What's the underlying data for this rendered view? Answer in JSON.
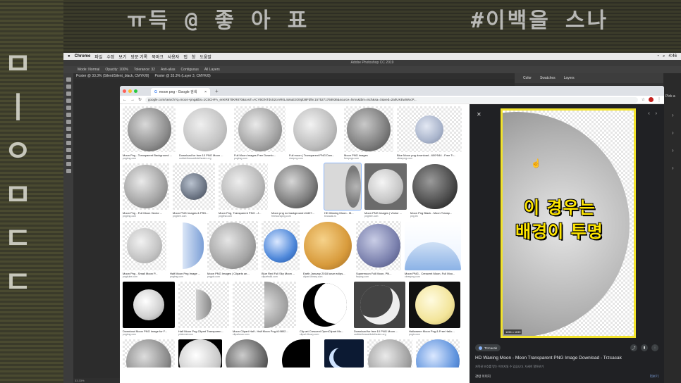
{
  "overlay": {
    "top_left": "ㅠ득 @ 좋 아 표",
    "top_right": "#이백을 스나",
    "left_column": "ㅁ ㅣ ㅇ ㅁ ㄷ ㄷ"
  },
  "menubar": {
    "app": "Chrome",
    "items": [
      "파일",
      "수정",
      "보기",
      "방문 기록",
      "북마크",
      "사용자",
      "탭",
      "창",
      "도움말"
    ],
    "right": "4:46"
  },
  "photoshop": {
    "title": "Adobe Photoshop CC 2019",
    "options": [
      "Mode: Normal",
      "Opacity: 100%",
      "Tolerance: 32",
      "Anti-alias",
      "Contiguous",
      "All Layers"
    ],
    "doc_tabs": [
      "Poster @ 33.3% (Silent/Silent_black, CMYK/8)",
      "Poster @ 33.3% (Layer 3, CMYK/8)"
    ],
    "panel_tabs": [
      "Color",
      "Swatches",
      "Layers"
    ],
    "side_label": "Pick a",
    "status": "33.33%"
  },
  "browser": {
    "tab_title": "moon png - Google 검색",
    "url": "google.com/search?q=moon+png&tbs=1C5CHFA_enKR870KR870&sxsrf=ACYBGNTdsS2cmR0L4s6uE3O0pl38Fdfw:1575271768936&source=lnms&tbm=isch&sa=X&ved=2ahUKEwiWxcP..."
  },
  "results": [
    [
      {
        "caption": "Moon Png - Transparent Background ...",
        "source": "pngimg.com"
      },
      {
        "caption": "Download for free 10 PNG Moon ...",
        "source": "carlisletheacarlisletheatre.org"
      },
      {
        "caption": "Full Moon Images Free Downlo...",
        "source": "pngimg.com"
      },
      {
        "caption": "Full moon | Transparent PNG Dow...",
        "source": "nicepng.com"
      },
      {
        "caption": "Moon PNG images",
        "source": "freepngs.com"
      },
      {
        "caption": "Blue Moon png download - 600*544 - Free Tr...",
        "source": "cleanpng.com"
      }
    ],
    [
      {
        "caption": "Moon Png - Full Moon Vector ...",
        "source": "pngimg.com"
      },
      {
        "caption": "Moon PNG Images & PSD...",
        "source": "pngtree.com"
      },
      {
        "caption": "Moon Png, Transparent PNG - J...",
        "source": "pngfind.com"
      },
      {
        "caption": "Moon png no background #4407...",
        "source": "freeiconspng.com"
      },
      {
        "caption": "HD Waning Moon - M...",
        "source": "trzcacak.rs"
      },
      {
        "caption": "Moon PNG Images | Vector ...",
        "source": "pngtree.com"
      },
      {
        "caption": "Moon Png Black - Moon Transp...",
        "source": "png.tm"
      }
    ],
    [
      {
        "caption": "Moon Png - Small Moon P...",
        "source": "pngkube.com"
      },
      {
        "caption": "Half Moon Png Image ...",
        "source": "pngimg.com"
      },
      {
        "caption": "Moon PNG Images | Cliparts an...",
        "source": "pngpix.com"
      },
      {
        "caption": "Blue Red Full Sky Moon ...",
        "source": "clipartwiki.com"
      },
      {
        "caption": "Earth January 2018 lunar eclips...",
        "source": "clipart-library.com"
      },
      {
        "caption": "Supermoon Full Moon, PN...",
        "source": "favpng.com"
      },
      {
        "caption": "Moon PNG - Crescent Moon, Full Moo...",
        "source": "cleanpng.com"
      }
    ],
    [
      {
        "caption": "Download Moon PNG Image for F...",
        "source": "pngimg.com"
      },
      {
        "caption": "Half Moon Png Clipart Transparen...",
        "source": "pinterest.com"
      },
      {
        "caption": "Moon Clipart Half - Half Moon Png #19802...",
        "source": "clipartmax.com"
      },
      {
        "caption": "Clip art Crescent OpenClipart Mo...",
        "source": "clipart-library.com"
      },
      {
        "caption": "Download for free 10 PNG Moon ...",
        "source": "carlisletheacarlisletheatre.org"
      },
      {
        "caption": "Halloween Moon Png & Free Hallo...",
        "source": "pngio.com"
      }
    ]
  ],
  "preview": {
    "caption_line1": "이 경우는",
    "caption_line2": "배경이 투명",
    "size": "1196 x 1199",
    "site": "Trzcacak",
    "title": "HD Waning Moon - Moon Transparent PNG Image Download - Trzcacak",
    "subtitle": "저작권 보호를 받는 이미지일 수 있습니다. 자세히 알아보기",
    "related": "관련 이미지",
    "more": "더보기"
  },
  "colors": {
    "caption": "#ffe600",
    "frame": "#f2e32c",
    "panel": "#202124"
  }
}
